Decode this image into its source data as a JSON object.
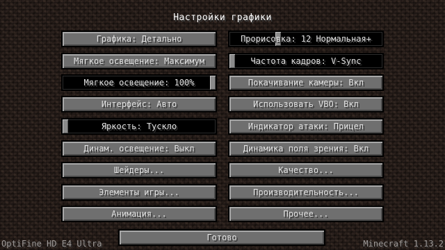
{
  "title": "Настройки графики",
  "left_options": [
    {
      "label": "Графика: Детально"
    },
    {
      "label": "Мягкое освещение: Максимум"
    },
    {
      "label": "Мягкое освещение: 100%"
    },
    {
      "label": "Интерфейс: Авто"
    },
    {
      "label": "Яркость: Тускло"
    },
    {
      "label": "Динам. освещение: Выкл"
    },
    {
      "label": "Шейдеры..."
    },
    {
      "label": "Элементы игры..."
    },
    {
      "label": "Анимация..."
    }
  ],
  "right_options": [
    {
      "label": "Прорисовка: 12 Нормальная+"
    },
    {
      "label": "Частота кадров: V-Sync"
    },
    {
      "label": "Покачивание камеры: Вкл"
    },
    {
      "label": "Использовать VBO: Вкл"
    },
    {
      "label": "Индикатор атаки: Прицел"
    },
    {
      "label": "Динамика поля зрения: Вкл"
    },
    {
      "label": "Качество..."
    },
    {
      "label": "Производительность..."
    },
    {
      "label": "Прочее..."
    }
  ],
  "sliders": {
    "smooth_lighting_level": 1.0,
    "brightness": 0.0,
    "render_distance": 0.31,
    "max_framerate": 0.0
  },
  "done_label": "Готово",
  "footer": {
    "left": "OptiFine HD E4 Ultra",
    "right": "Minecraft 1.13.2"
  }
}
